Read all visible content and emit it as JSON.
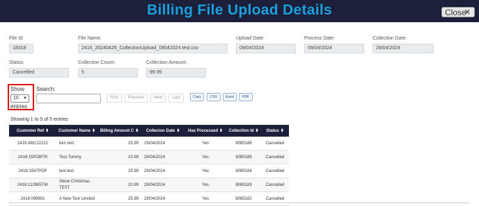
{
  "header": {
    "title": "Billing File Upload Details",
    "close_label": "Close",
    "close_icon": "close-icon"
  },
  "fields": {
    "file_id": {
      "label": "File Id:",
      "value": "18318"
    },
    "file_name": {
      "label": "File Name:",
      "value": "2416_20240429_CollectionUpload_09042024 test.csv"
    },
    "upload_date": {
      "label": "Upload Date:",
      "value": "09/04/2024"
    },
    "process_date": {
      "label": "Process Date:",
      "value": "09/04/2024"
    },
    "collection_date": {
      "label": "Collection Date:",
      "value": "29/04/2024"
    },
    "status": {
      "label": "Status:",
      "value": "Cancelled"
    },
    "collection_count": {
      "label": "Collection Count:",
      "value": "5"
    },
    "collection_amount": {
      "label": "Collection Amount:",
      "value": "99.95"
    }
  },
  "controls": {
    "show_label": "Show",
    "entries_label": "entries",
    "length_value": "10",
    "search_label": "Search:",
    "search_value": "",
    "pager": {
      "first": "First",
      "previous": "Previous",
      "next": "Next",
      "last": "Last"
    },
    "export": {
      "copy": "Copy",
      "csv": "CSV",
      "excel": "Excel",
      "pdf": "PDF"
    }
  },
  "table": {
    "info": "Showing 1 to 5 of 5 entries",
    "columns": [
      "Customer Ref",
      "Customer Name",
      "Billing Amount C",
      "Collecion Date",
      "Has Processed",
      "Collection Id",
      "Status"
    ],
    "rows": [
      [
        "2416:ABC22222",
        "ben test",
        "25.99",
        "29/04/2024",
        "Yes",
        "8085186",
        "Cancelled"
      ],
      [
        "2416:15POBTR",
        "Test Tommy",
        "10.99",
        "29/04/2024",
        "Yes",
        "8085185",
        "Cancelled"
      ],
      [
        "2416:1547POP",
        "test test",
        "25.99",
        "29/04/2024",
        "Yes",
        "8085184",
        "Cancelled"
      ],
      [
        "2416:112865TW",
        "Steve Christmas TEST",
        "10.99",
        "29/04/2024",
        "Yes",
        "8085183",
        "Cancelled"
      ],
      [
        "2416:099801",
        "A New Test Limited",
        "25.99",
        "29/04/2024",
        "Yes",
        "8085182",
        "Cancelled"
      ]
    ]
  },
  "colors": {
    "header_bg": "#1b1f3a",
    "title": "#1aa0dc",
    "highlight": "#dd1111"
  }
}
